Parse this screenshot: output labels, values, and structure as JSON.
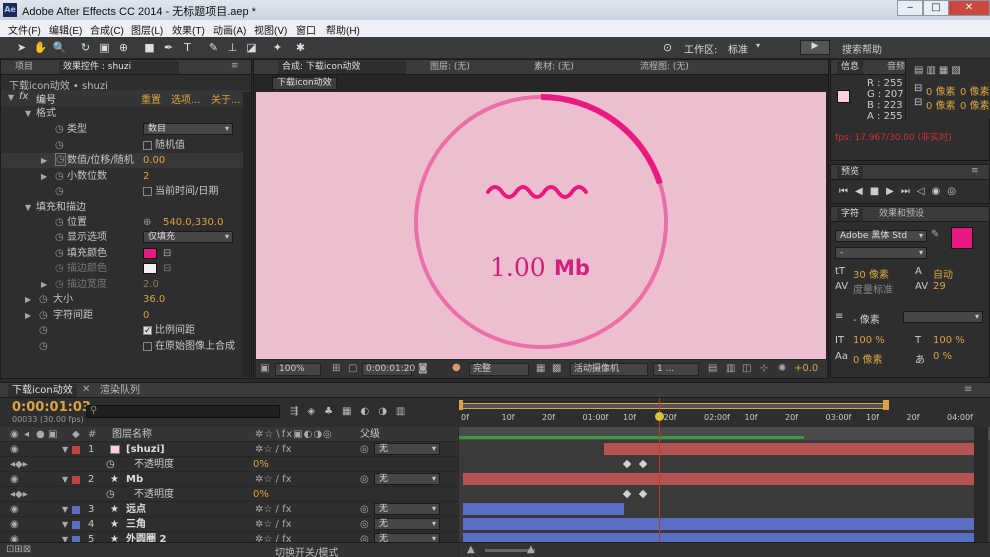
{
  "window": {
    "title": "Adobe After Effects CC 2014 - 无标题项目.aep *",
    "app_icon": "Ae"
  },
  "menu": [
    "文件(F)",
    "编辑(E)",
    "合成(C)",
    "图层(L)",
    "效果(T)",
    "动画(A)",
    "视图(V)",
    "窗口",
    "帮助(H)"
  ],
  "toolbar": {
    "workspace_label": "工作区:",
    "workspace_value": "标准",
    "search_help": "搜索帮助"
  },
  "left_panel": {
    "tabs": [
      "项目",
      "效果控件 : shuzi"
    ],
    "breadcrumb": "下载icon动效 • shuzi",
    "effect_name": "编号",
    "effect_links": [
      "重置",
      "选项...",
      "关于..."
    ],
    "props": {
      "format": "格式",
      "type_label": "类型",
      "type_value": "数目",
      "random_label": "随机值",
      "offset_label": "数值/位移/随机",
      "offset_value": "0.00",
      "decimals_label": "小数位数",
      "decimals_value": "2",
      "datetime_label": "当前时间/日期",
      "fill_stroke": "填充和描边",
      "position_label": "位置",
      "position_value": "540.0,330.0",
      "display_label": "显示选项",
      "display_value": "仅填充",
      "fill_color_label": "填充颜色",
      "stroke_color_label": "描边颜色",
      "stroke_width_label": "描边宽度",
      "stroke_width_value": "2.0",
      "size_label": "大小",
      "size_value": "36.0",
      "tracking_label": "字符间距",
      "tracking_value": "0",
      "proportional_label": "比例间距",
      "composite_label": "在原始图像上合成"
    }
  },
  "comp_panel": {
    "tabs": [
      "合成: 下载icon动效",
      "图层: (无)",
      "素材: (无)",
      "流程图: (无)"
    ],
    "sub_tab": "下载icon动效",
    "number_text": "1.00",
    "unit_text": "Mb",
    "progress": 0.2,
    "bottom": {
      "zoom": "100%",
      "time": "0:00:01:20",
      "resolution": "完整",
      "camera": "活动摄像机",
      "views": "1 ...",
      "exposure": "+0.0"
    }
  },
  "info_panel": {
    "tabs": [
      "信息",
      "音频"
    ],
    "r": "R : 255",
    "g": "G : 207",
    "b": "B : 223",
    "a": "A : 255",
    "fps": "fps: 17.967/30.00 (非实时)"
  },
  "align": {
    "px1": "0 像素",
    "px2": "0 像素",
    "px3": "0 像素",
    "px4": "0 像素"
  },
  "preview_panel": {
    "tab": "预览"
  },
  "char_panel": {
    "tabs": [
      "字符",
      "效果和预设"
    ],
    "font": "Adobe 黑体 Std",
    "style": "-",
    "size": "30 像素",
    "leading": "自动",
    "kerning": "度量标准",
    "tracking": "29",
    "stroke": "- 像素",
    "vscale": "100 %",
    "hscale": "100 %",
    "baseline": "0 像素",
    "tsume": "0 %"
  },
  "timeline": {
    "tabs": [
      "下载icon动效",
      "渲染队列"
    ],
    "timecode": "0:00:01:03",
    "frame_info": "00033 (30.00 fps)",
    "col_layer_name": "图层名称",
    "col_parent": "父级",
    "layers": [
      {
        "num": "1",
        "name": "[shuzi]",
        "sub": "不透明度",
        "sub_value": "0%",
        "parent": "无",
        "color": "#c24242"
      },
      {
        "num": "2",
        "name": "Mb",
        "sub": "不透明度",
        "sub_value": "0%",
        "parent": "无",
        "color": "#c24242"
      },
      {
        "num": "3",
        "name": "远点",
        "parent": "无",
        "color": "#5a6fc4"
      },
      {
        "num": "4",
        "name": "三角",
        "parent": "无",
        "color": "#5a6fc4"
      },
      {
        "num": "5",
        "name": "外圆圈 2",
        "parent": "无",
        "color": "#5a6fc4"
      }
    ],
    "ruler": [
      "0f",
      "10f",
      "20f",
      "01:00f",
      "10f",
      "20f",
      "02:00f",
      "10f",
      "20f",
      "03:00f",
      "10f",
      "20f",
      "04:00f"
    ],
    "footer": "切换开关/模式"
  },
  "colors": {
    "pink": "#e8197f",
    "comp_bg": "#edbed0",
    "ring": "#e96fa8",
    "timecode": "#d9a441"
  }
}
